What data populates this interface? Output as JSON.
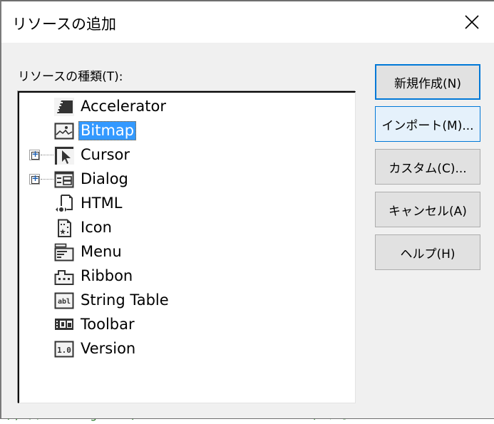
{
  "dialog": {
    "title": "リソースの追加",
    "close_icon": "close-icon"
  },
  "resource_type_label": "リソースの種類(T):",
  "tree": {
    "items": [
      {
        "label": "Accelerator",
        "icon": "accelerator-icon",
        "expandable": false,
        "selected": false
      },
      {
        "label": "Bitmap",
        "icon": "bitmap-icon",
        "expandable": false,
        "selected": true
      },
      {
        "label": "Cursor",
        "icon": "cursor-icon",
        "expandable": true,
        "selected": false
      },
      {
        "label": "Dialog",
        "icon": "dialog-icon",
        "expandable": true,
        "selected": false
      },
      {
        "label": "HTML",
        "icon": "html-icon",
        "expandable": false,
        "selected": false
      },
      {
        "label": "Icon",
        "icon": "icon-resource-icon",
        "expandable": false,
        "selected": false
      },
      {
        "label": "Menu",
        "icon": "menu-icon",
        "expandable": false,
        "selected": false
      },
      {
        "label": "Ribbon",
        "icon": "ribbon-icon",
        "expandable": false,
        "selected": false
      },
      {
        "label": "String Table",
        "icon": "string-table-icon",
        "expandable": false,
        "selected": false
      },
      {
        "label": "Toolbar",
        "icon": "toolbar-icon",
        "expandable": false,
        "selected": false
      },
      {
        "label": "Version",
        "icon": "version-icon",
        "expandable": false,
        "selected": false
      }
    ]
  },
  "buttons": {
    "new": "新規作成(N)",
    "import": "インポート(M)...",
    "custom": "カスタム(C)...",
    "cancel": "キャンセル(A)",
    "help": "ヘルプ(H)"
  },
  "background_code": {
    "text_a": "E / ",
    "text_kw": "MB_OKCANCEL",
    "text_b": "); // MessageBox( Close SmallWindow OK? ) 表示"
  },
  "colors": {
    "selection": "#3399ff",
    "default_button_border": "#0078d7",
    "hover_button_bg": "#e5f1fb"
  }
}
